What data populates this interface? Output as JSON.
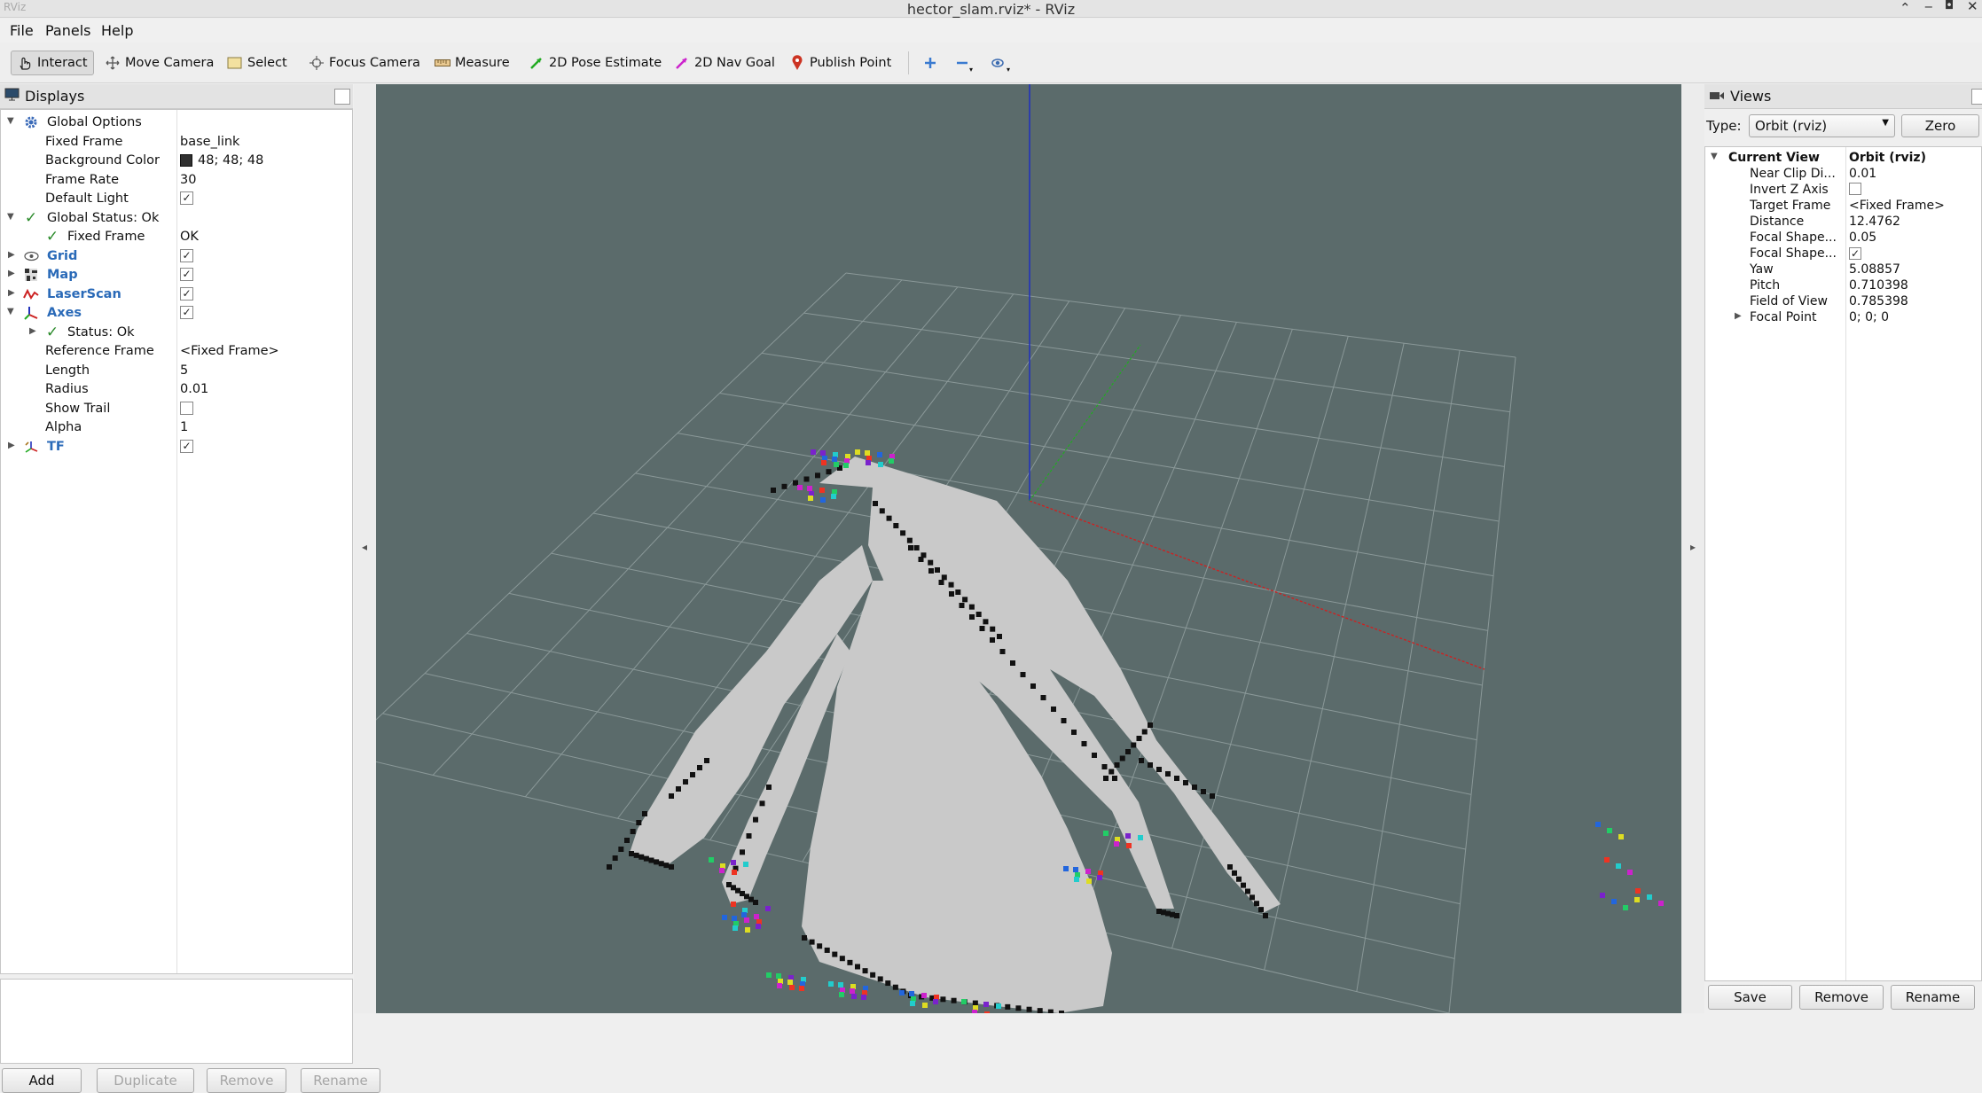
{
  "window": {
    "app_id": "RViz",
    "title": "hector_slam.rviz* - RViz"
  },
  "menu": [
    "File",
    "Panels",
    "Help"
  ],
  "toolbar": {
    "tools": [
      {
        "label": "Interact",
        "icon": "interact-icon",
        "active": true
      },
      {
        "label": "Move Camera",
        "icon": "move-camera-icon"
      },
      {
        "label": "Select",
        "icon": "select-icon"
      },
      {
        "label": "Focus Camera",
        "icon": "focus-camera-icon"
      },
      {
        "label": "Measure",
        "icon": "measure-icon"
      },
      {
        "label": "2D Pose Estimate",
        "icon": "pose-estimate-icon",
        "color": "#22aa22"
      },
      {
        "label": "2D Nav Goal",
        "icon": "nav-goal-icon",
        "color": "#cc22cc"
      },
      {
        "label": "Publish Point",
        "icon": "publish-point-icon",
        "color": "#cc3322"
      }
    ],
    "extra_icons": [
      "add-tool-icon",
      "remove-tool-icon",
      "camera-type-icon"
    ]
  },
  "displays": {
    "title": "Displays",
    "rows": [
      {
        "label": "Global Options",
        "icon": "gear-icon"
      },
      {
        "label": "Fixed Frame",
        "value": "base_link"
      },
      {
        "label": "Background Color",
        "value": "48; 48; 48",
        "color": "#303030"
      },
      {
        "label": "Frame Rate",
        "value": "30"
      },
      {
        "label": "Default Light",
        "checked": true
      },
      {
        "label": "Global Status: Ok",
        "icon": "check-icon"
      },
      {
        "label": "Fixed Frame",
        "value": "OK",
        "icon": "check-icon"
      },
      {
        "label": "Grid",
        "icon": "grid-icon",
        "checked": true
      },
      {
        "label": "Map",
        "icon": "map-icon",
        "checked": true
      },
      {
        "label": "LaserScan",
        "icon": "laserscan-icon",
        "checked": true
      },
      {
        "label": "Axes",
        "icon": "axes-icon",
        "checked": true
      },
      {
        "label": "Status: Ok",
        "icon": "check-icon"
      },
      {
        "label": "Reference Frame",
        "value": "<Fixed Frame>"
      },
      {
        "label": "Length",
        "value": "5"
      },
      {
        "label": "Radius",
        "value": "0.01"
      },
      {
        "label": "Show Trail",
        "checked": false
      },
      {
        "label": "Alpha",
        "value": "1"
      },
      {
        "label": "TF",
        "icon": "tf-icon",
        "checked": true
      }
    ],
    "buttons": [
      "Add",
      "Duplicate",
      "Remove",
      "Rename"
    ]
  },
  "views": {
    "title": "Views",
    "type_label": "Type:",
    "type_value": "Orbit (rviz)",
    "zero_label": "Zero",
    "current_view_label": "Current View",
    "current_view_value": "Orbit (rviz)",
    "props": [
      {
        "label": "Near Clip Di...",
        "value": "0.01"
      },
      {
        "label": "Invert Z Axis",
        "checked": false
      },
      {
        "label": "Target Frame",
        "value": "<Fixed Frame>"
      },
      {
        "label": "Distance",
        "value": "12.4762"
      },
      {
        "label": "Focal Shape...",
        "value": "0.05"
      },
      {
        "label": "Focal Shape...",
        "checked": true
      },
      {
        "label": "Yaw",
        "value": "5.08857"
      },
      {
        "label": "Pitch",
        "value": "0.710398"
      },
      {
        "label": "Field of View",
        "value": "0.785398"
      },
      {
        "label": "Focal Point",
        "value": "0; 0; 0"
      }
    ],
    "buttons": [
      "Save",
      "Remove",
      "Rename"
    ]
  },
  "viewport": {
    "background": "#5b6b6b",
    "grid_color": "#8a9898",
    "map_free_color": "#c9c9c9",
    "map_occupied_color": "#111111",
    "axis_x_color": "#cc2222",
    "axis_y_color": "#22aa22",
    "axis_z_color": "#2233bb"
  }
}
